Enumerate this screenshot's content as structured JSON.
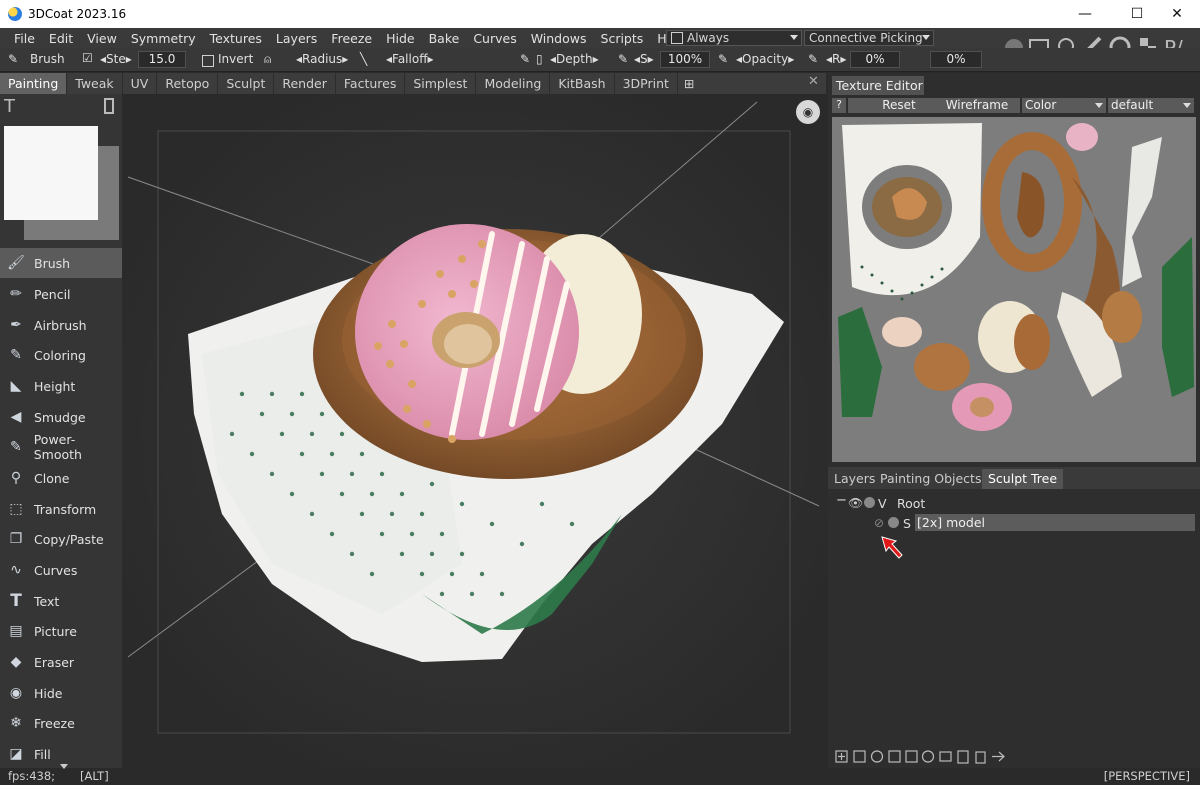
{
  "window": {
    "title": "3DCoat 2023.16",
    "minimize": "—",
    "maximize": "☐",
    "close": "✕"
  },
  "menu": [
    "File",
    "Edit",
    "View",
    "Symmetry",
    "Textures",
    "Layers",
    "Freeze",
    "Hide",
    "Bake",
    "Curves",
    "Windows",
    "Scripts",
    "Help"
  ],
  "always_dropdown": "Always",
  "picking_dropdown": "Connective  Picking",
  "toolbar": {
    "tool": "Brush",
    "step_label": "Ste",
    "step_value": "15.0",
    "invert": "Invert",
    "radius": "Radius",
    "falloff": "Falloff",
    "depth": "Depth",
    "s_label": "S",
    "s_value": "100%",
    "opacity": "Opacity",
    "r_label": "R",
    "r_value": "0%",
    "m_value": "0%"
  },
  "rooms": [
    "Painting",
    "Tweak",
    "UV",
    "Retopo",
    "Sculpt",
    "Render",
    "Factures",
    "Simplest",
    "Modeling",
    "KitBash",
    "3DPrint"
  ],
  "active_room": "Painting",
  "tools": [
    "Brush",
    "Pencil",
    "Airbrush",
    "Coloring",
    "Height",
    "Smudge",
    "Power-Smooth",
    "Clone",
    "Transform",
    "Copy/Paste",
    "Curves",
    "Text",
    "Picture",
    "Eraser",
    "Hide",
    "Freeze",
    "Fill"
  ],
  "selected_tool": "Brush",
  "texture_editor": {
    "title": "Texture  Editor",
    "help": "?",
    "reset": "Reset",
    "wireframe": "Wireframe",
    "channel": "Color",
    "preset": "default"
  },
  "panel_tabs": [
    "Layers",
    "Painting  Objects",
    "Sculpt  Tree"
  ],
  "active_panel_tab": "Sculpt  Tree",
  "tree": {
    "root_flag": "V",
    "root_label": "Root",
    "child_flag": "S",
    "child_label": "[2x]  model"
  },
  "status": {
    "fps": "fps:438;",
    "key": "[ALT]",
    "view": "[PERSPECTIVE]"
  },
  "colors": {
    "bg": "#2b2b2b",
    "panel": "#353535",
    "selected": "#5b5b5b",
    "accent_green": "#4caf50",
    "arrow_red": "#e01818"
  }
}
